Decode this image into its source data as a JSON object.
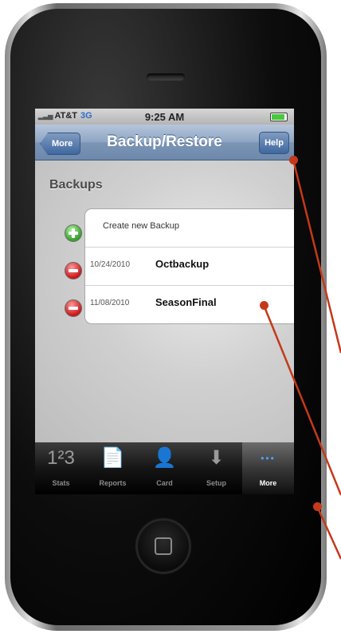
{
  "status_bar": {
    "carrier": "AT&T",
    "network": "3G",
    "time": "9:25 AM"
  },
  "nav": {
    "title": "Backup/Restore",
    "back_label": "More",
    "help_label": "Help"
  },
  "section": {
    "header": "Backups"
  },
  "backups": {
    "create_label": "Create new Backup",
    "rows": [
      {
        "date": "10/24/2010",
        "name": "Octbackup"
      },
      {
        "date": "11/08/2010",
        "name": "SeasonFinal"
      }
    ]
  },
  "tabbar": {
    "items": [
      {
        "label": "Stats",
        "icon": "1²3"
      },
      {
        "label": "Reports",
        "icon": "📄"
      },
      {
        "label": "Card",
        "icon": "👤"
      },
      {
        "label": "Setup",
        "icon": "⬇"
      },
      {
        "label": "More",
        "icon": "•••"
      }
    ],
    "active": "More"
  },
  "colors": {
    "navbar": "#7c95b6",
    "accent_add": "#3aa02c",
    "accent_delete": "#c81818",
    "callout": "#c4391a"
  }
}
